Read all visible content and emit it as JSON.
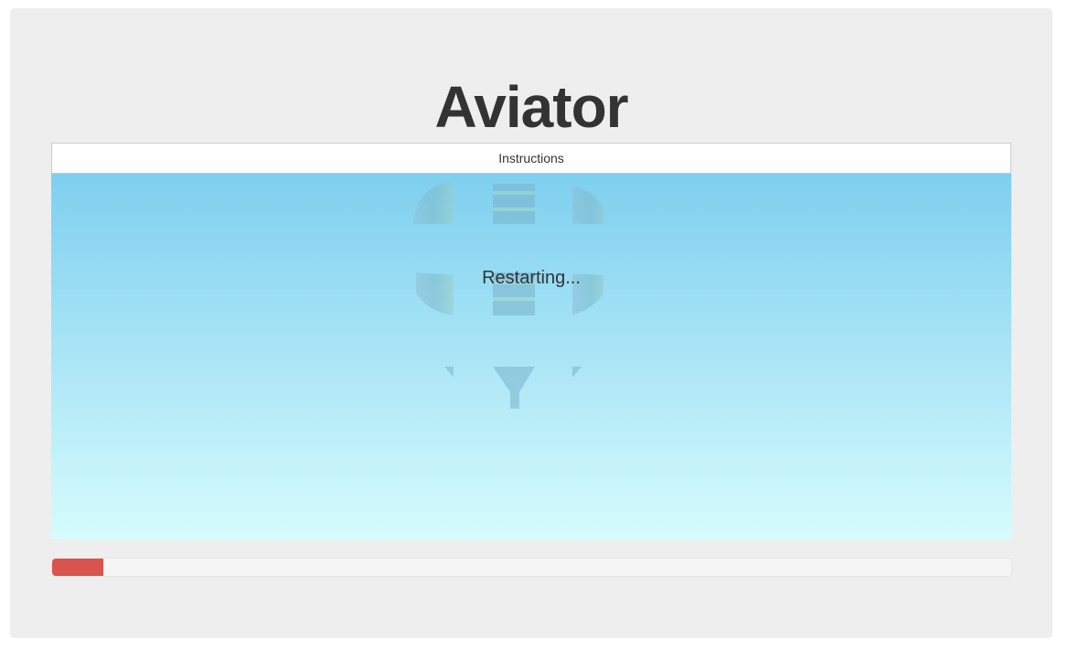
{
  "app": {
    "title": "Aviator"
  },
  "instructions": {
    "label": "Instructions"
  },
  "game": {
    "status_text": "Restarting...",
    "sky_top_color": "#7ecfef",
    "sky_bottom_color": "#d6fcfd"
  },
  "progress": {
    "fraction": 0.053,
    "color": "#d9534f"
  }
}
